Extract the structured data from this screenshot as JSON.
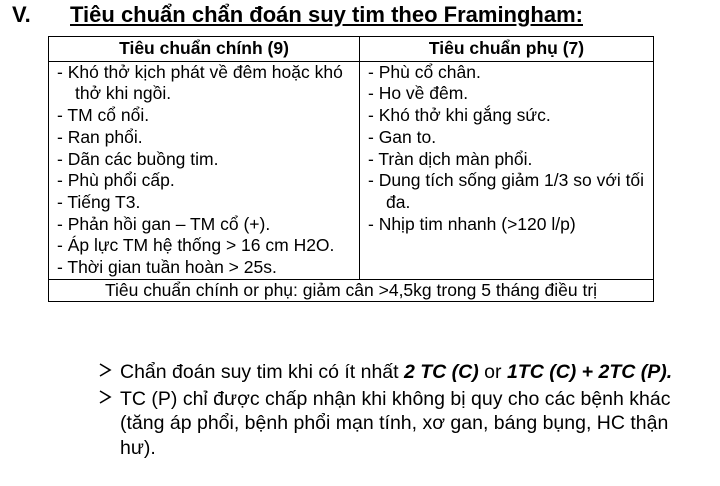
{
  "section": {
    "number": "V.",
    "title": "Tiêu chuẩn chẩn đoán suy tim theo Framingham:"
  },
  "table": {
    "headers": [
      "Tiêu chuẩn chính (9)",
      "Tiêu chuẩn phụ (7)"
    ],
    "major": [
      "- Khó thở kịch phát về đêm hoặc khó thở khi ngồi.",
      "- TM cổ nổi.",
      "- Ran phổi.",
      "- Dãn các buồng tim.",
      "- Phù phổi cấp.",
      "- Tiếng T3.",
      "- Phản hồi gan – TM cổ (+).",
      "- Áp lực TM hệ thống > 16 cm H2O.",
      "- Thời gian tuần hoàn > 25s."
    ],
    "minor": [
      "- Phù cổ chân.",
      "- Ho về đêm.",
      "- Khó thở khi gắng sức.",
      "- Gan to.",
      "- Tràn dịch màn phổi.",
      "- Dung tích sống giảm 1/3 so với tối đa.",
      "- Nhịp tim nhanh (>120 l/p)"
    ],
    "footer": "Tiêu chuẩn chính or phụ: giảm cân >4,5kg trong 5 tháng điều trị"
  },
  "bullets": {
    "b1": {
      "prefix": "Chẩn đoán suy tim khi có ít nhất ",
      "bold1": "2 TC (C)",
      "middle": " or ",
      "bold2": "1TC (C) + 2TC (P)."
    },
    "b2": "TC (P) chỉ được chấp nhận khi không bị quy cho các bệnh khác (tăng áp phổi, bệnh phổi mạn tính, xơ gan, báng bụng, HC thận hư)."
  },
  "icons": {
    "bullet": "arrow-bullet-icon"
  }
}
